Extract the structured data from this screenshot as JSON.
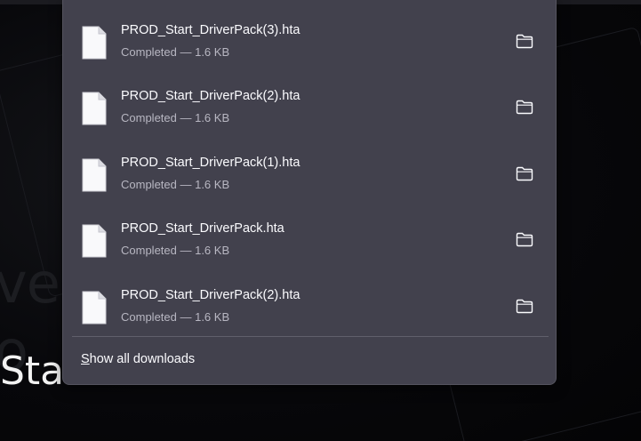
{
  "background": {
    "heading_text": "Start DriverPack",
    "faded_text_1": "ver",
    "faded_text_2": "o"
  },
  "downloads_panel": {
    "items": [
      {
        "filename": "PROD_Start_DriverPack(3).hta",
        "status": "Completed — 1.6 KB",
        "icon": "file-icon",
        "action_icon": "folder-icon"
      },
      {
        "filename": "PROD_Start_DriverPack(2).hta",
        "status": "Completed — 1.6 KB",
        "icon": "file-icon",
        "action_icon": "folder-icon"
      },
      {
        "filename": "PROD_Start_DriverPack(1).hta",
        "status": "Completed — 1.6 KB",
        "icon": "file-icon",
        "action_icon": "folder-icon"
      },
      {
        "filename": "PROD_Start_DriverPack.hta",
        "status": "Completed — 1.6 KB",
        "icon": "file-icon",
        "action_icon": "folder-icon"
      },
      {
        "filename": "PROD_Start_DriverPack(2).hta",
        "status": "Completed — 1.6 KB",
        "icon": "file-icon",
        "action_icon": "folder-icon"
      }
    ],
    "footer": {
      "show_all_accesskey": "S",
      "show_all_rest": "how all downloads"
    }
  },
  "colors": {
    "panel_bg": "#42414d",
    "text_primary": "#fbfbfe",
    "text_secondary": "#b8b7c2",
    "page_bg": "#060608"
  }
}
